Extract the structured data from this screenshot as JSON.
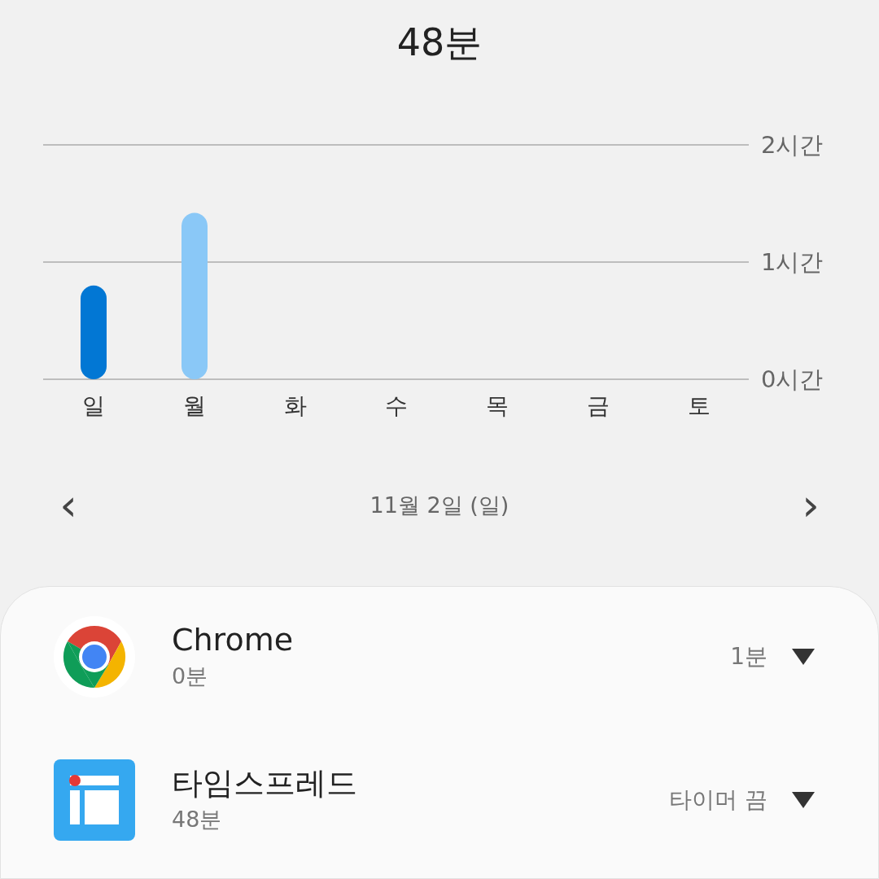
{
  "title": "48분",
  "chart_data": {
    "type": "bar",
    "categories": [
      "일",
      "월",
      "화",
      "수",
      "목",
      "금",
      "토"
    ],
    "ylim": [
      0,
      2
    ],
    "yticks": [
      {
        "value": 0,
        "label": "0시간"
      },
      {
        "value": 1,
        "label": "1시간"
      },
      {
        "value": 2,
        "label": "2시간"
      }
    ],
    "values": [
      0.8,
      1.42,
      null,
      null,
      null,
      null,
      null
    ]
  },
  "day_bars": [
    {
      "color": "#0277d4"
    },
    {
      "color": "#8ac8f7"
    }
  ],
  "date_nav": {
    "prev": "‹",
    "label": "11월 2일 (일)",
    "next": "›"
  },
  "apps": [
    {
      "kind": "chrome",
      "name": "Chrome",
      "usage": "0분",
      "limit": "1분"
    },
    {
      "kind": "timespread",
      "name": "타임스프레드",
      "usage": "48분",
      "limit": "타이머 끔"
    }
  ]
}
